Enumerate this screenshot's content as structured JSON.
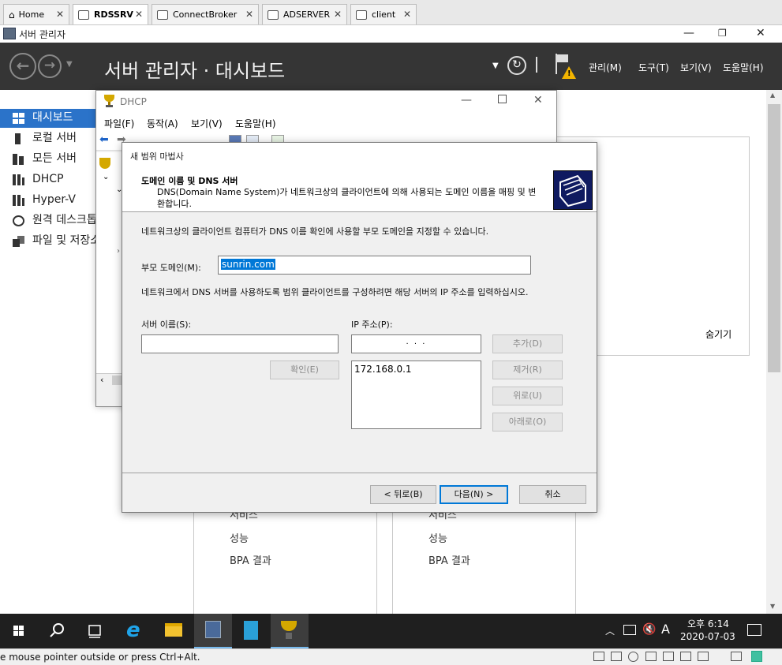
{
  "vm_tabs": [
    {
      "label": "Home"
    },
    {
      "label": "RDSSRV"
    },
    {
      "label": "ConnectBroker"
    },
    {
      "label": "ADSERVER"
    },
    {
      "label": "client"
    }
  ],
  "server_manager": {
    "window_title": "서버 관리자",
    "header_title": "서버 관리자 · 대시보드",
    "menu": [
      "관리(M)",
      "도구(T)",
      "보기(V)",
      "도움말(H)"
    ],
    "sidebar": [
      {
        "label": "대시보드"
      },
      {
        "label": "로컬 서버"
      },
      {
        "label": "모든 서버"
      },
      {
        "label": "DHCP"
      },
      {
        "label": "Hyper-V"
      },
      {
        "label": "원격 데스크톱 서비스"
      },
      {
        "label": "파일 및 저장소 서비스"
      }
    ],
    "hide_label": "숨기기",
    "tiles": [
      {
        "items": [
          "서비스",
          "성능",
          "BPA 결과"
        ]
      },
      {
        "items": [
          "서비스",
          "성능",
          "BPA 결과"
        ]
      }
    ]
  },
  "dhcp": {
    "title": "DHCP",
    "menu": [
      "파일(F)",
      "동작(A)",
      "보기(V)",
      "도움말(H)"
    ]
  },
  "wizard": {
    "title": "새 범위 마법사",
    "heading": "도메인 이름 및 DNS 서버",
    "description": "DNS(Domain Name System)가 네트워크상의 클라이언트에 의해 사용되는 도메인 이름을 매핑 및 변환합니다.",
    "intro": "네트워크상의 클라이언트 컴퓨터가 DNS 이름 확인에 사용할 부모 도메인을 지정할 수 있습니다.",
    "parent_domain_label": "부모 도메인(M):",
    "parent_domain_value": "sunrin.com",
    "dns_instruction": "네트워크에서 DNS 서버를 사용하도록 범위 클라이언트를 구성하려면 해당 서버의 IP 주소를 입력하십시오.",
    "server_name_label": "서버 이름(S):",
    "server_name_value": "",
    "ip_label": "IP 주소(P):",
    "ip_input": ".   .   .",
    "ip_list": [
      "172.168.0.1"
    ],
    "resolve_button": "확인(E)",
    "add_button": "추가(D)",
    "remove_button": "제거(R)",
    "up_button": "위로(U)",
    "down_button": "아래로(O)",
    "back_button": "< 뒤로(B)",
    "next_button": "다음(N) >",
    "cancel_button": "취소"
  },
  "taskbar": {
    "time": "오후 6:14",
    "date": "2020-07-03",
    "ime": "A"
  },
  "status": {
    "text": "e mouse pointer outside or press Ctrl+Alt."
  },
  "colors": {
    "header_bg": "#353535",
    "sidebar_active": "#2b73c9",
    "taskbar_bg": "#1f1f1f",
    "selection": "#0078d7"
  }
}
